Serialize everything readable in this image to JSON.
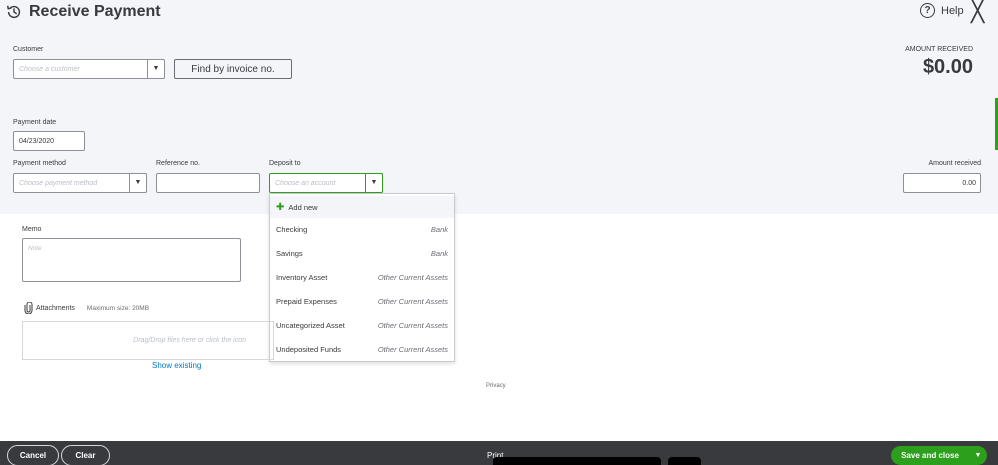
{
  "header": {
    "title": "Receive Payment",
    "help_label": "Help",
    "close_glyph": "╳"
  },
  "customer": {
    "label": "Customer",
    "placeholder": "Choose a customer",
    "find_button": "Find by invoice no."
  },
  "amount_received_top": {
    "label": "AMOUNT RECEIVED",
    "value": "$0.00"
  },
  "payment_date": {
    "label": "Payment date",
    "value": "04/23/2020"
  },
  "payment_method": {
    "label": "Payment method",
    "placeholder": "Choose payment method"
  },
  "reference": {
    "label": "Reference no.",
    "value": ""
  },
  "deposit_to": {
    "label": "Deposit to",
    "placeholder": "Choose an account",
    "options": [
      {
        "name": "Checking",
        "type": "Bank"
      },
      {
        "name": "Savings",
        "type": "Bank"
      },
      {
        "name": "Inventory Asset",
        "type": "Other Current Assets"
      },
      {
        "name": "Prepaid Expenses",
        "type": "Other Current Assets"
      },
      {
        "name": "Uncategorized Asset",
        "type": "Other Current Assets"
      },
      {
        "name": "Undeposited Funds",
        "type": "Other Current Assets"
      }
    ],
    "add_new": "Add new"
  },
  "amount_received_field": {
    "label": "Amount received",
    "value": "0.00"
  },
  "memo": {
    "label": "Memo",
    "placeholder": "Note"
  },
  "attachments": {
    "label": "Attachments",
    "max_size": "Maximum size: 20MB",
    "drop_text": "Drag/Drop files here or click the icon",
    "show_existing": "Show existing"
  },
  "privacy": "Privacy",
  "footer": {
    "cancel": "Cancel",
    "clear": "Clear",
    "print": "Print",
    "save_close": "Save and close"
  },
  "colors": {
    "accent_green": "#2ca01c",
    "footer_bg": "#393a3d",
    "link_blue": "#0077c5"
  }
}
